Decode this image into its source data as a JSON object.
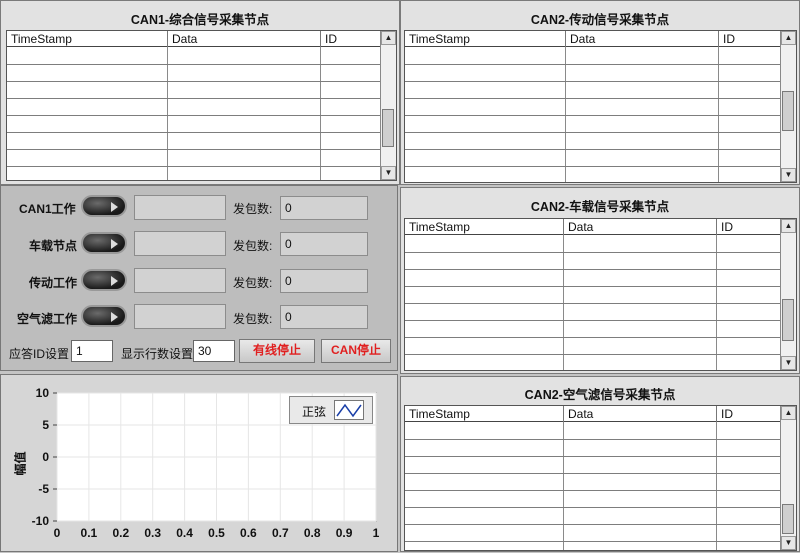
{
  "tables": [
    {
      "title": "CAN1-综合信号采集节点",
      "columns": [
        "TimeStamp",
        "Data",
        "ID"
      ]
    },
    {
      "title": "CAN2-传动信号采集节点",
      "columns": [
        "TimeStamp",
        "Data",
        "ID"
      ]
    },
    {
      "title": "CAN2-车载信号采集节点",
      "columns": [
        "TimeStamp",
        "Data",
        "ID"
      ]
    },
    {
      "title": "CAN2-空气滤信号采集节点",
      "columns": [
        "TimeStamp",
        "Data",
        "ID"
      ]
    }
  ],
  "scroll_up": "▲",
  "scroll_down": "▼",
  "controls": {
    "rows": [
      {
        "label": "CAN1工作",
        "pkt_label": "发包数:",
        "pkt_value": "0"
      },
      {
        "label": "车载节点",
        "pkt_label": "发包数:",
        "pkt_value": "0"
      },
      {
        "label": "传动工作",
        "pkt_label": "发包数:",
        "pkt_value": "0"
      },
      {
        "label": "空气滤工作",
        "pkt_label": "发包数:",
        "pkt_value": "0"
      }
    ],
    "ack_id_label": "应答ID设置",
    "ack_id_value": "1",
    "rows_label": "显示行数设置",
    "rows_value": "30",
    "wired_stop": "有线停止",
    "can_stop": "CAN停止"
  },
  "chart_data": {
    "type": "line",
    "series": [
      {
        "name": "正弦",
        "x": [],
        "values": []
      }
    ],
    "ylabel": "幅值",
    "xlabel": "",
    "xlim": [
      0,
      1
    ],
    "ylim": [
      -10,
      10
    ],
    "x_ticks": [
      "0",
      "0.1",
      "0.2",
      "0.3",
      "0.4",
      "0.5",
      "0.6",
      "0.7",
      "0.8",
      "0.9",
      "1"
    ],
    "y_ticks": [
      "10",
      "5",
      "0",
      "-5",
      "-10"
    ],
    "grid": true,
    "legend_position": "top-right"
  }
}
